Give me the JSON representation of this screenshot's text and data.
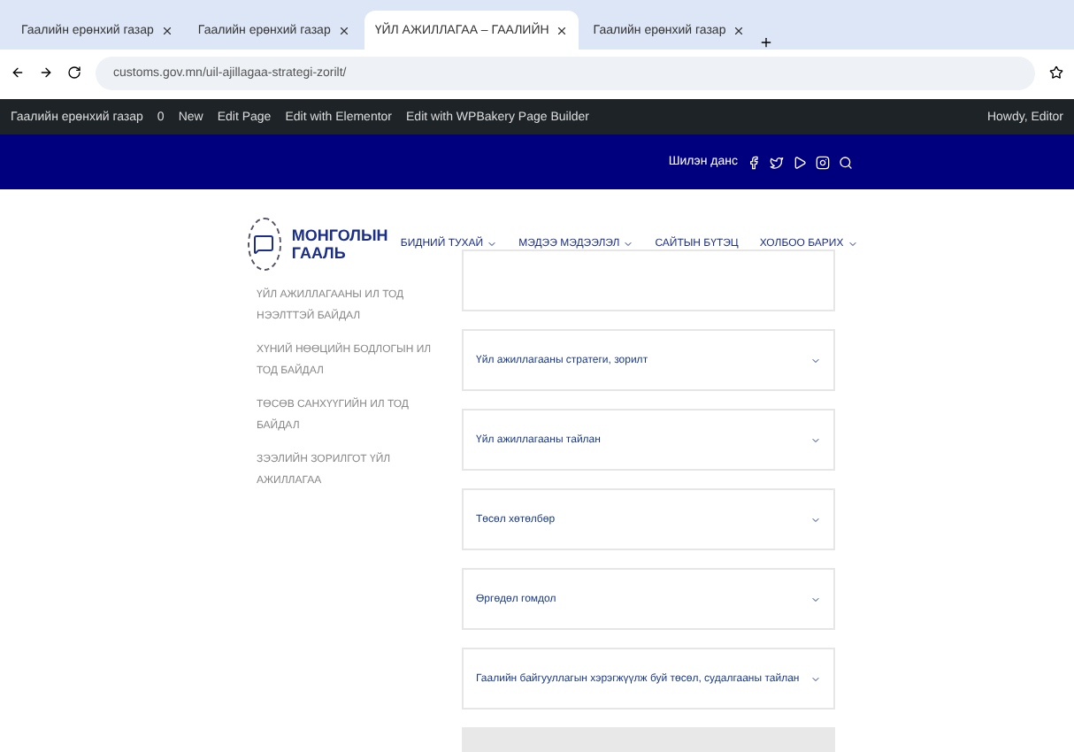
{
  "browser": {
    "tabs": [
      {
        "title": "Гаалийн ерөнхий газар",
        "selected": false
      },
      {
        "title": "Гаалийн ерөнхий газар",
        "selected": false
      },
      {
        "title": "ҮЙЛ АЖИЛЛАГАА – ГААЛИЙН",
        "selected": true
      },
      {
        "title": "Гаалийн ерөнхий газар",
        "selected": false
      }
    ],
    "url": "customs.gov.mn/uil-ajillagaa-strategi-zorilt/"
  },
  "admin_bar": {
    "items": [
      "Гаалийн ерөнхий газар",
      "0",
      "New",
      "Edit Page",
      "Edit with Elementor",
      "Edit with WPBakery Page Builder"
    ],
    "greeting": "Howdy, Editor"
  },
  "top_bar": {
    "label": "Шилэн данс"
  },
  "site": {
    "logo": "МОНГОЛЫН ГААЛЬ",
    "nav": [
      "БИДНИЙ ТУХАЙ",
      "МЭДЭЭ МЭДЭЭЛЭЛ",
      "САЙТЫН БҮТЭЦ",
      "ХОЛБОО БАРИХ"
    ]
  },
  "sidebar": {
    "items": [
      "ҮЙЛ АЖИЛЛАГААНЫ ИЛ ТОД НЭЭЛТТЭЙ БАЙДАЛ",
      "ХҮНИЙ НӨӨЦИЙН БОДЛОГЫН ИЛ ТОД БАЙДАЛ",
      "ТӨСӨВ САНХҮҮГИЙН ИЛ ТОД БАЙДАЛ",
      "ЗЭЭЛИЙН ЗОРИЛГОТ ҮЙЛ АЖИЛЛАГАА"
    ]
  },
  "accordion": [
    {
      "title": "Үйл ажиллагааны стратеги, зорилт",
      "expanded": false
    },
    {
      "title": "Үйл ажиллагааны тайлан",
      "expanded": false
    },
    {
      "title": "Төсөл хөтөлбөр",
      "expanded": false
    },
    {
      "title": "Өргөдөл гомдол",
      "expanded": false
    },
    {
      "title": "Гаалийн байгууллагын хэрэгжүүлж буй төсөл, судалгааны тайлан",
      "expanded": false
    }
  ]
}
